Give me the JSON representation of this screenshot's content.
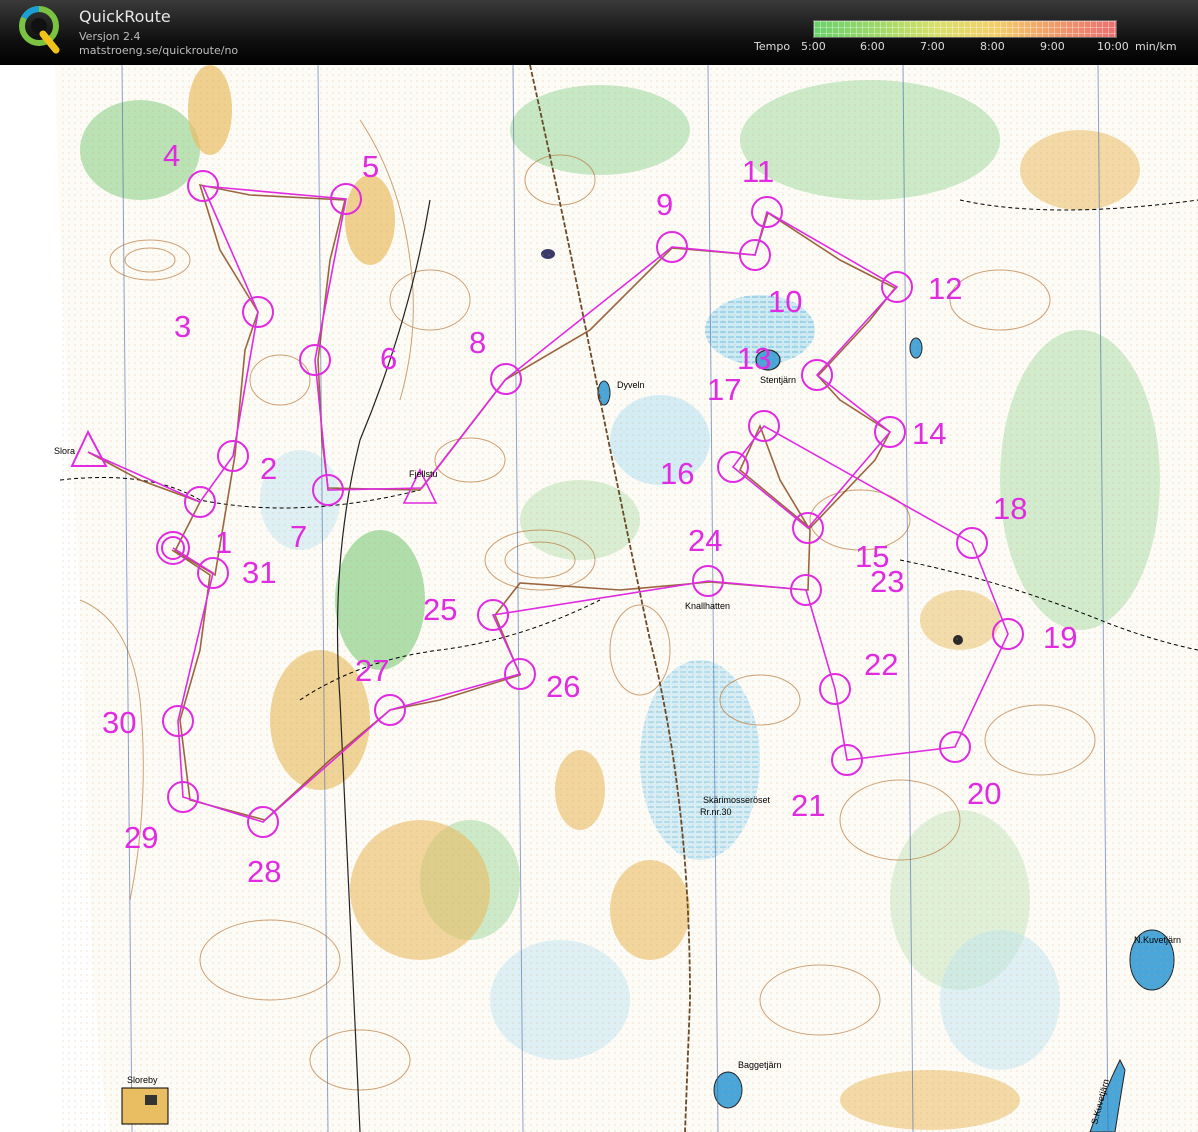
{
  "app": {
    "name": "QuickRoute",
    "version": "Versjon 2.4",
    "url": "matstroeng.se/quickroute/no"
  },
  "tempo_legend": {
    "label": "Tempo",
    "ticks": [
      "5:00",
      "6:00",
      "7:00",
      "8:00",
      "9:00",
      "10:00"
    ],
    "unit": "min/km"
  },
  "map": {
    "place_names": {
      "slora": "Slora",
      "fjellstu": "Fjellstu",
      "dyveln": "Dyveln",
      "stentjarn": "Stentjärn",
      "knallhatten": "Knallhatten",
      "skarimosseroset": "Skärimosseröset",
      "rrnr": "Rr.nr.30",
      "nkuvetjarn": "N.Kuvetjärn",
      "skuvetjarn": "S.Kuvetjärn",
      "baggetjarn": "Baggetjärn",
      "sloreby": "Sloreby"
    },
    "controls": [
      {
        "label": "1"
      },
      {
        "label": "2"
      },
      {
        "label": "3"
      },
      {
        "label": "4"
      },
      {
        "label": "5"
      },
      {
        "label": "6"
      },
      {
        "label": "7"
      },
      {
        "label": "8"
      },
      {
        "label": "9"
      },
      {
        "label": "10"
      },
      {
        "label": "11"
      },
      {
        "label": "12"
      },
      {
        "label": "13"
      },
      {
        "label": "14"
      },
      {
        "label": "15"
      },
      {
        "label": "16"
      },
      {
        "label": "17"
      },
      {
        "label": "18"
      },
      {
        "label": "19"
      },
      {
        "label": "20"
      },
      {
        "label": "21"
      },
      {
        "label": "22"
      },
      {
        "label": "23"
      },
      {
        "label": "24"
      },
      {
        "label": "25"
      },
      {
        "label": "26"
      },
      {
        "label": "27"
      },
      {
        "label": "28"
      },
      {
        "label": "29"
      },
      {
        "label": "30"
      },
      {
        "label": "31"
      }
    ],
    "colors": {
      "course": "#e02be0",
      "route": "#8a4a20",
      "forest_open": "#e7b75a",
      "vegetation": "#6cc86c",
      "water": "#a8dcef",
      "contour": "#b87a3e"
    }
  }
}
